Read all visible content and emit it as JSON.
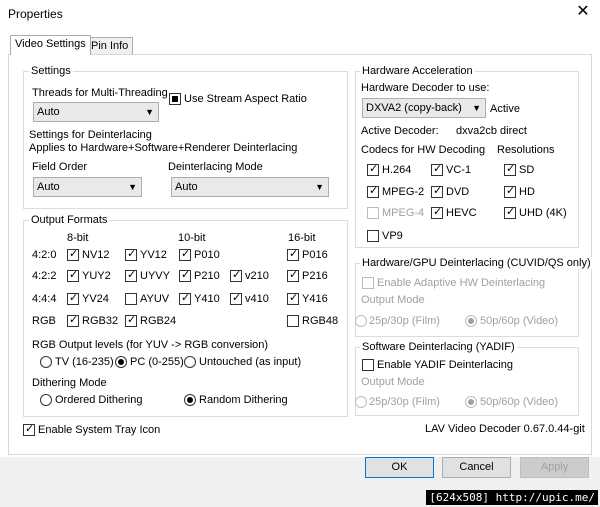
{
  "window": {
    "title": "Properties",
    "close_glyph": "✕"
  },
  "tabs": [
    {
      "label": "Video Settings",
      "active": true
    },
    {
      "label": "Pin Info",
      "active": false
    }
  ],
  "settings": {
    "group_label": "Settings",
    "threads_label": "Threads for Multi-Threading",
    "threads_value": "Auto",
    "aspect_ratio_label": "Use Stream Aspect Ratio",
    "aspect_ratio_state": "indeterminate",
    "deint_heading": "Settings for Deinterlacing",
    "deint_subheading": "Applies to Hardware+Software+Renderer Deinterlacing",
    "field_order_label": "Field Order",
    "field_order_value": "Auto",
    "deint_mode_label": "Deinterlacing Mode",
    "deint_mode_value": "Auto"
  },
  "output_formats": {
    "group_label": "Output Formats",
    "headers": {
      "h8": "8-bit",
      "h10": "10-bit",
      "h16": "16-bit"
    },
    "rows": [
      {
        "label": "4:2:0",
        "items": [
          {
            "label": "NV12",
            "checked": true
          },
          {
            "label": "YV12",
            "checked": true
          },
          {
            "label": "P010",
            "checked": true
          },
          {
            "label": "",
            "checked": null
          },
          {
            "label": "P016",
            "checked": true
          }
        ]
      },
      {
        "label": "4:2:2",
        "items": [
          {
            "label": "YUY2",
            "checked": true
          },
          {
            "label": "UYVY",
            "checked": true
          },
          {
            "label": "P210",
            "checked": true
          },
          {
            "label": "v210",
            "checked": true
          },
          {
            "label": "P216",
            "checked": true
          }
        ]
      },
      {
        "label": "4:4:4",
        "items": [
          {
            "label": "YV24",
            "checked": true
          },
          {
            "label": "AYUV",
            "checked": false
          },
          {
            "label": "Y410",
            "checked": true
          },
          {
            "label": "v410",
            "checked": true
          },
          {
            "label": "Y416",
            "checked": true
          }
        ]
      },
      {
        "label": "RGB",
        "items": [
          {
            "label": "RGB32",
            "checked": true
          },
          {
            "label": "RGB24",
            "checked": true
          },
          {
            "label": "",
            "checked": null
          },
          {
            "label": "",
            "checked": null
          },
          {
            "label": "RGB48",
            "checked": false
          }
        ]
      }
    ],
    "rgb_levels_label": "RGB Output levels (for YUV -> RGB conversion)",
    "rgb_levels": [
      {
        "label": "TV (16-235)",
        "selected": false
      },
      {
        "label": "PC (0-255)",
        "selected": true
      },
      {
        "label": "Untouched (as input)",
        "selected": false
      }
    ],
    "dither_label": "Dithering Mode",
    "dither": [
      {
        "label": "Ordered Dithering",
        "selected": false
      },
      {
        "label": "Random Dithering",
        "selected": true
      }
    ]
  },
  "tray": {
    "label": "Enable System Tray Icon",
    "checked": true
  },
  "hw": {
    "group_label": "Hardware Acceleration",
    "decoder_label": "Hardware Decoder to use:",
    "decoder_value": "DXVA2 (copy-back)",
    "decoder_status": "Active",
    "active_decoder_label": "Active Decoder:",
    "active_decoder_value": "dxva2cb direct",
    "codecs_label": "Codecs for HW Decoding",
    "resolutions_label": "Resolutions",
    "codecs": [
      {
        "label": "H.264",
        "checked": true,
        "disabled": false
      },
      {
        "label": "VC-1",
        "checked": true,
        "disabled": false
      },
      {
        "label": "MPEG-2",
        "checked": true,
        "disabled": false
      },
      {
        "label": "DVD",
        "checked": true,
        "disabled": false
      },
      {
        "label": "MPEG-4",
        "checked": false,
        "disabled": true
      },
      {
        "label": "HEVC",
        "checked": true,
        "disabled": false
      },
      {
        "label": "VP9",
        "checked": false,
        "disabled": false
      }
    ],
    "resolutions": [
      {
        "label": "SD",
        "checked": true
      },
      {
        "label": "HD",
        "checked": true
      },
      {
        "label": "UHD (4K)",
        "checked": true
      }
    ]
  },
  "hw_deint": {
    "group_label": "Hardware/GPU Deinterlacing (CUVID/QS only)",
    "adaptive_label": "Enable Adaptive HW Deinterlacing",
    "output_mode_label": "Output Mode",
    "modes": [
      {
        "label": "25p/30p (Film)",
        "selected": false
      },
      {
        "label": "50p/60p (Video)",
        "selected": true
      }
    ]
  },
  "sw_deint": {
    "group_label": "Software Deinterlacing (YADIF)",
    "yadif_label": "Enable YADIF Deinterlacing",
    "output_mode_label": "Output Mode",
    "modes": [
      {
        "label": "25p/30p (Film)",
        "selected": false
      },
      {
        "label": "50p/60p (Video)",
        "selected": true
      }
    ]
  },
  "version": "LAV Video Decoder 0.67.0.44-git",
  "buttons": {
    "ok": "OK",
    "cancel": "Cancel",
    "apply": "Apply"
  },
  "watermark": "[624x508] http://upic.me/"
}
